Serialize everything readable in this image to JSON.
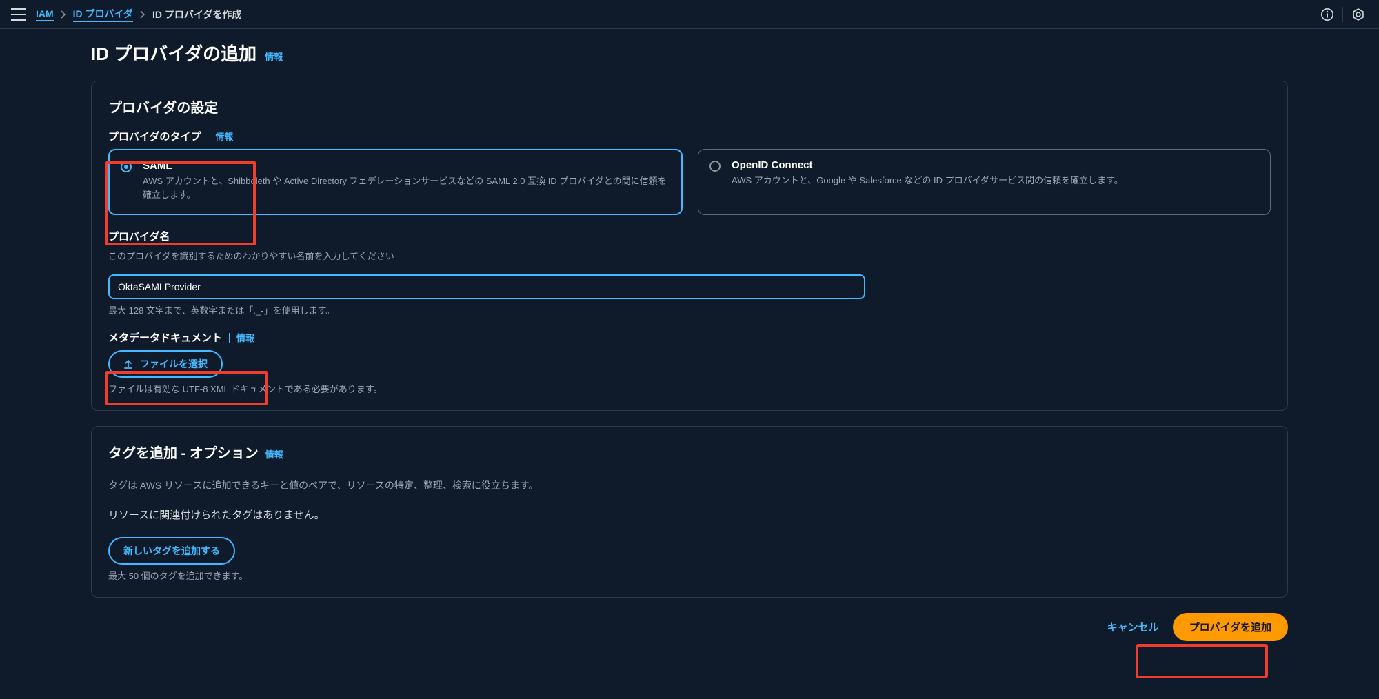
{
  "topbar": {
    "breadcrumb": {
      "root": "IAM",
      "mid": "ID プロバイダ",
      "current": "ID プロバイダを作成"
    }
  },
  "page": {
    "title": "ID プロバイダの追加",
    "info": "情報"
  },
  "config": {
    "heading": "プロバイダの設定",
    "typeLabel": "プロバイダのタイプ",
    "typeInfo": "情報",
    "saml": {
      "title": "SAML",
      "desc": "AWS アカウントと、Shibboleth や Active Directory フェデレーションサービスなどの SAML 2.0 互換 ID プロバイダとの間に信頼を確立します。"
    },
    "oidc": {
      "title": "OpenID Connect",
      "desc": "AWS アカウントと、Google や Salesforce などの ID プロバイダサービス間の信頼を確立します。"
    },
    "nameLabel": "プロバイダ名",
    "nameHelp": "このプロバイダを識別するためのわかりやすい名前を入力してください",
    "nameValue": "OktaSAMLProvider",
    "nameHint": "最大 128 文字まで、英数字または「._-」を使用します。",
    "metaLabel": "メタデータドキュメント",
    "metaInfo": "情報",
    "fileBtn": "ファイルを選択",
    "fileHint": "ファイルは有効な UTF-8 XML ドキュメントである必要があります。"
  },
  "tags": {
    "heading": "タグを追加 - オプション",
    "info": "情報",
    "desc": "タグは AWS リソースに追加できるキーと値のペアで、リソースの特定、整理、検索に役立ちます。",
    "status": "リソースに関連付けられたタグはありません。",
    "addBtn": "新しいタグを追加する",
    "hint": "最大 50 個のタグを追加できます。"
  },
  "footer": {
    "cancel": "キャンセル",
    "submit": "プロバイダを追加"
  }
}
